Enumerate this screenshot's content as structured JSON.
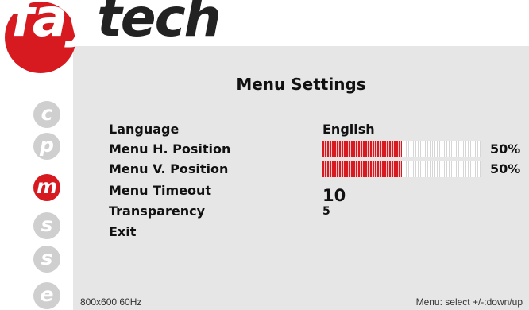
{
  "brand": {
    "part1": "fay",
    "part2": "tech"
  },
  "side_menu": [
    "c",
    "p",
    "m",
    "s",
    "s",
    "e"
  ],
  "active_side_item": "m",
  "title": "Menu Settings",
  "settings": {
    "language": {
      "label": "Language",
      "value": "English"
    },
    "h_position": {
      "label": "Menu H. Position",
      "percent_text": "50%",
      "level": 0.5
    },
    "v_position": {
      "label": "Menu V. Position",
      "percent_text": "50%",
      "level": 0.5
    },
    "timeout": {
      "label": "Menu Timeout",
      "value": "10"
    },
    "transparency": {
      "label": "Transparency",
      "value": "5"
    },
    "exit": {
      "label": "Exit"
    }
  },
  "footer": {
    "resolution": "800x600 60Hz",
    "hint": "Menu: select +/-:down/up"
  },
  "colors": {
    "accent": "#d71920",
    "panel": "#e6e6e6",
    "inactive_icon": "#cfcfcf"
  }
}
